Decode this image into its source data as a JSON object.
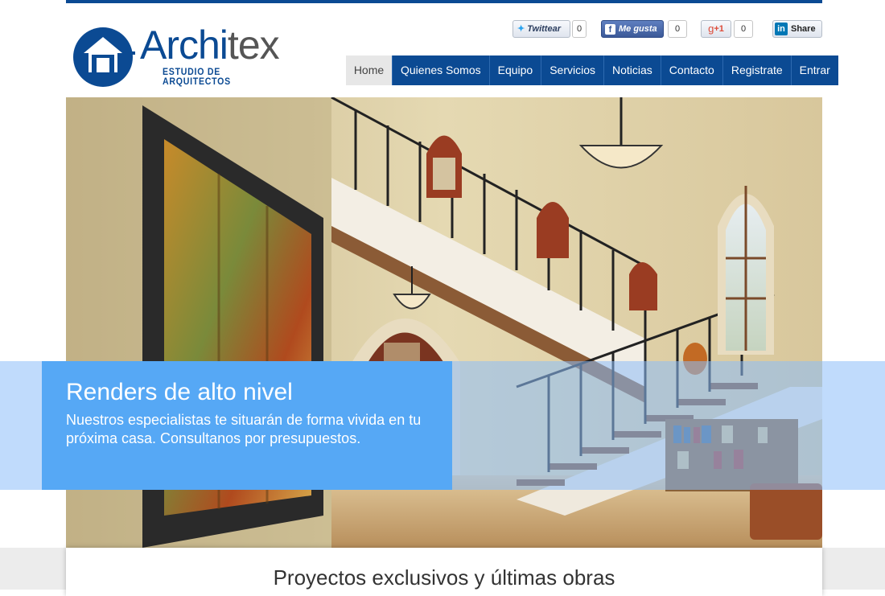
{
  "brand": {
    "name_part1": "Archi",
    "name_part2": "tex",
    "tagline": "ESTUDIO DE ARQUITECTOS"
  },
  "social": {
    "twitter_label": "Twittear",
    "twitter_count": "0",
    "facebook_label": "Me gusta",
    "facebook_count": "0",
    "gplus_label": "+1",
    "gplus_count": "0",
    "linkedin_label": "Share"
  },
  "nav": {
    "items": [
      "Home",
      "Quienes Somos",
      "Equipo",
      "Servicios",
      "Noticias",
      "Contacto",
      "Registrate",
      "Entrar"
    ],
    "active": "Home"
  },
  "hero": {
    "title": "Renders de alto nivel",
    "text": "Nuestros especialistas te situarán de forma vivida en tu próxima casa. Consultanos por presupuestos."
  },
  "section": {
    "title": "Proyectos exclusivos y últimas obras"
  },
  "colors": {
    "brand_blue": "#0b4a93",
    "caption_blue": "#56a8f5"
  }
}
